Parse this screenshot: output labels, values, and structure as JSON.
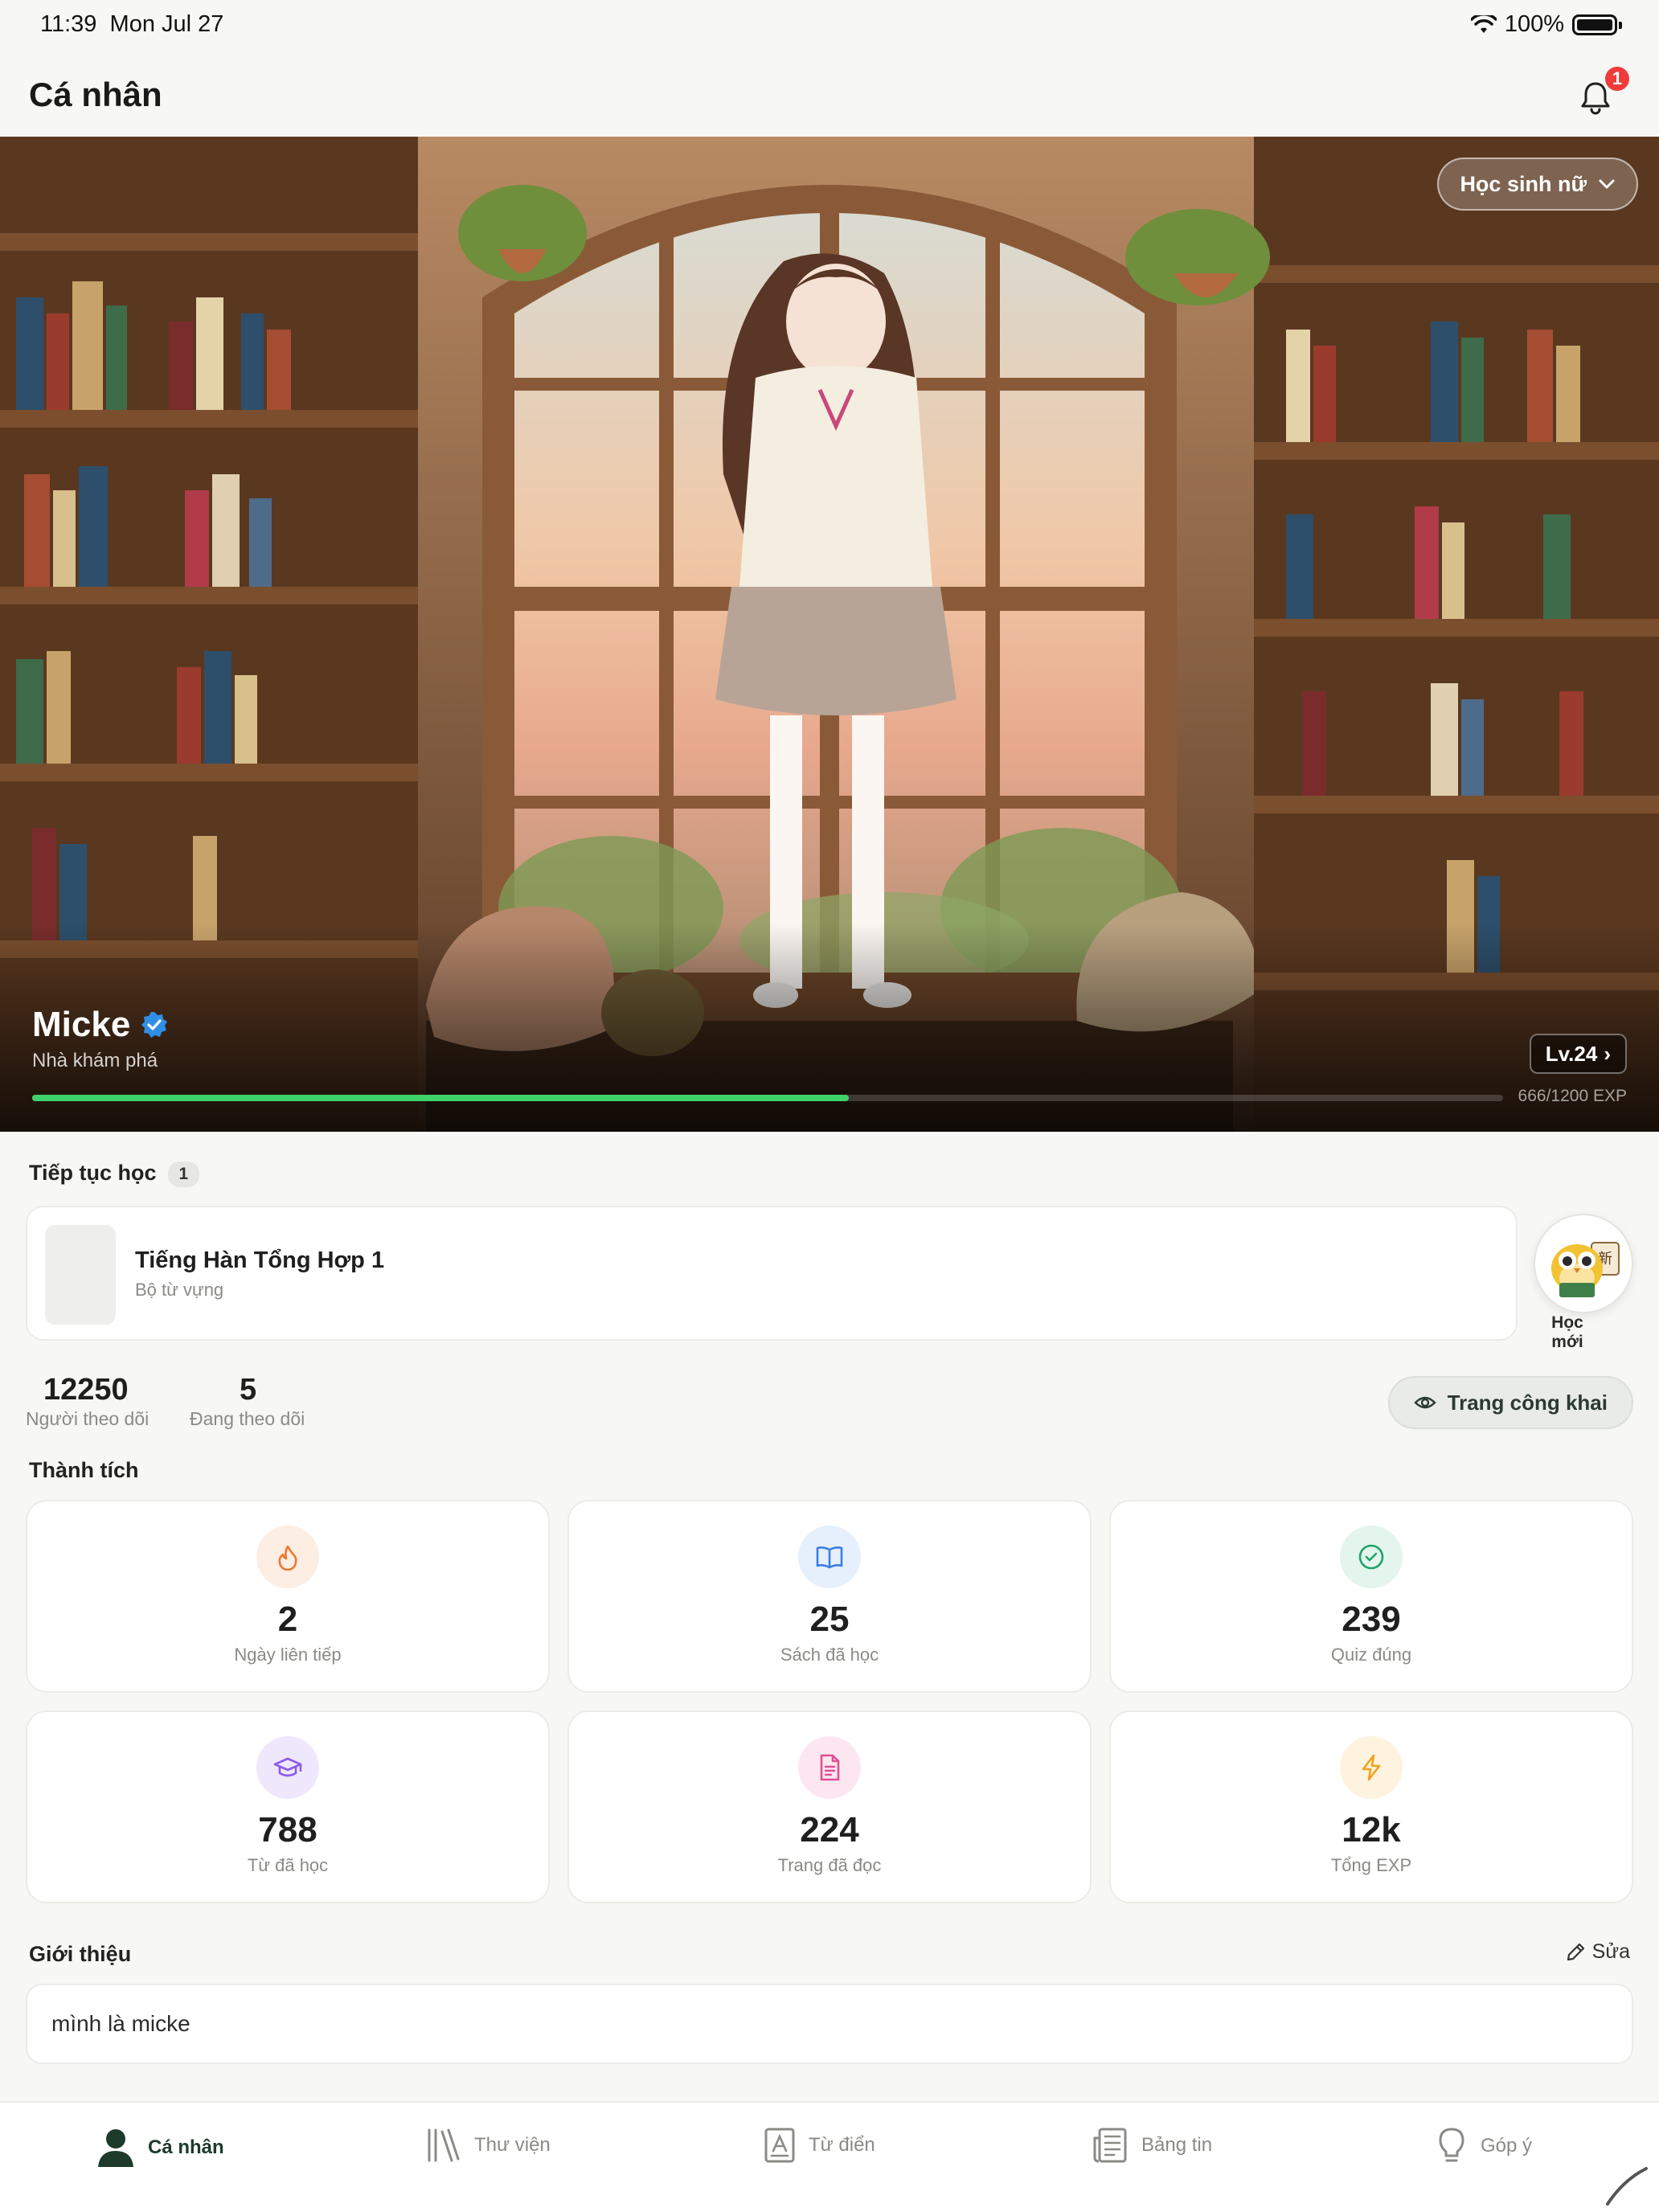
{
  "status_bar": {
    "time": "11:39",
    "date": "Mon Jul 27",
    "battery": "100%"
  },
  "header": {
    "title": "Cá nhân",
    "notification_count": "1"
  },
  "hero": {
    "character_select": "Học sinh nữ",
    "user_name": "Micke",
    "user_title": "Nhà khám phá",
    "level": "Lv.24",
    "exp_text": "666/1200 EXP",
    "exp_fraction": 0.555
  },
  "continue": {
    "label": "Tiếp tục học",
    "count": "1",
    "course_title": "Tiếng Hàn Tổng Hợp 1",
    "course_sub": "Bộ từ vựng",
    "learn_new_label": "Học mới"
  },
  "follow": {
    "followers_value": "12250",
    "followers_label": "Người theo dõi",
    "following_value": "5",
    "following_label": "Đang theo dõi",
    "public_page": "Trang công khai"
  },
  "achievements": {
    "label": "Thành tích",
    "items": [
      {
        "value": "2",
        "label": "Ngày liên tiếp",
        "icon": "flame-icon",
        "color": "#f0772e",
        "bg": "#fdeee3"
      },
      {
        "value": "25",
        "label": "Sách đã học",
        "icon": "book-open-icon",
        "color": "#3a7fe0",
        "bg": "#e6effc"
      },
      {
        "value": "239",
        "label": "Quiz đúng",
        "icon": "check-circle-icon",
        "color": "#1fa36b",
        "bg": "#e3f5ec"
      },
      {
        "value": "788",
        "label": "Từ đã học",
        "icon": "graduation-cap-icon",
        "color": "#8a5ce6",
        "bg": "#efe8fc"
      },
      {
        "value": "224",
        "label": "Trang đã đọc",
        "icon": "document-icon",
        "color": "#e04f93",
        "bg": "#fce7f1"
      },
      {
        "value": "12k",
        "label": "Tổng EXP",
        "icon": "lightning-icon",
        "color": "#f0a21b",
        "bg": "#fdf3df"
      }
    ]
  },
  "intro": {
    "label": "Giới thiệu",
    "edit": "Sửa",
    "text": "mình là micke"
  },
  "tabs": [
    {
      "label": "Cá nhân",
      "icon": "person-icon",
      "active": true
    },
    {
      "label": "Thư viện",
      "icon": "library-icon",
      "active": false
    },
    {
      "label": "Từ điển",
      "icon": "dictionary-icon",
      "active": false
    },
    {
      "label": "Bảng tin",
      "icon": "newspaper-icon",
      "active": false
    },
    {
      "label": "Góp ý",
      "icon": "lightbulb-icon",
      "active": false
    }
  ]
}
